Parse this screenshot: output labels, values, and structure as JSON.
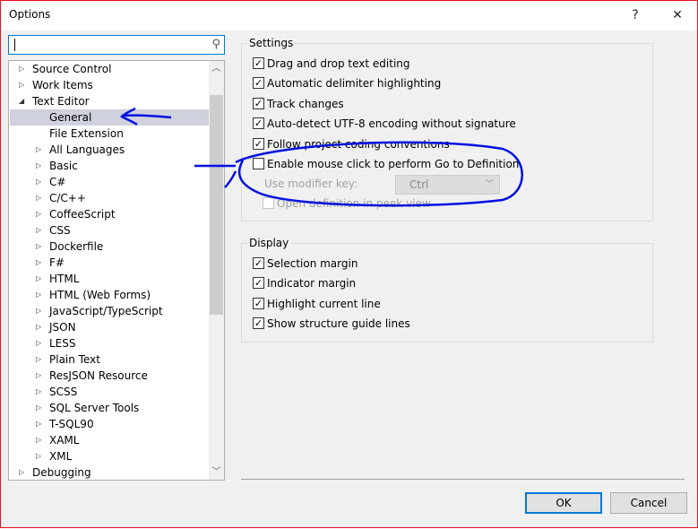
{
  "window": {
    "title": "Options",
    "help": "?",
    "close": "✕"
  },
  "search": {
    "value": "",
    "icon": "search-icon"
  },
  "tree": [
    {
      "label": "Source Control",
      "level": 0,
      "arrow": "collapsed"
    },
    {
      "label": "Work Items",
      "level": 0,
      "arrow": "collapsed"
    },
    {
      "label": "Text Editor",
      "level": 0,
      "arrow": "expanded"
    },
    {
      "label": "General",
      "level": 1,
      "arrow": "none",
      "selected": true
    },
    {
      "label": "File Extension",
      "level": 1,
      "arrow": "none"
    },
    {
      "label": "All Languages",
      "level": 1,
      "arrow": "collapsed"
    },
    {
      "label": "Basic",
      "level": 1,
      "arrow": "collapsed"
    },
    {
      "label": "C#",
      "level": 1,
      "arrow": "collapsed"
    },
    {
      "label": "C/C++",
      "level": 1,
      "arrow": "collapsed"
    },
    {
      "label": "CoffeeScript",
      "level": 1,
      "arrow": "collapsed"
    },
    {
      "label": "CSS",
      "level": 1,
      "arrow": "collapsed"
    },
    {
      "label": "Dockerfile",
      "level": 1,
      "arrow": "collapsed"
    },
    {
      "label": "F#",
      "level": 1,
      "arrow": "collapsed"
    },
    {
      "label": "HTML",
      "level": 1,
      "arrow": "collapsed"
    },
    {
      "label": "HTML (Web Forms)",
      "level": 1,
      "arrow": "collapsed"
    },
    {
      "label": "JavaScript/TypeScript",
      "level": 1,
      "arrow": "collapsed"
    },
    {
      "label": "JSON",
      "level": 1,
      "arrow": "collapsed"
    },
    {
      "label": "LESS",
      "level": 1,
      "arrow": "collapsed"
    },
    {
      "label": "Plain Text",
      "level": 1,
      "arrow": "collapsed"
    },
    {
      "label": "ResJSON Resource",
      "level": 1,
      "arrow": "collapsed"
    },
    {
      "label": "SCSS",
      "level": 1,
      "arrow": "collapsed"
    },
    {
      "label": "SQL Server Tools",
      "level": 1,
      "arrow": "collapsed"
    },
    {
      "label": "T-SQL90",
      "level": 1,
      "arrow": "collapsed"
    },
    {
      "label": "XAML",
      "level": 1,
      "arrow": "collapsed"
    },
    {
      "label": "XML",
      "level": 1,
      "arrow": "collapsed"
    },
    {
      "label": "Debugging",
      "level": 0,
      "arrow": "collapsed"
    }
  ],
  "settings": {
    "title": "Settings",
    "items": [
      {
        "label": "Drag and drop text editing",
        "checked": true
      },
      {
        "label": "Automatic delimiter highlighting",
        "checked": true
      },
      {
        "label": "Track changes",
        "checked": true
      },
      {
        "label": "Auto-detect UTF-8 encoding without signature",
        "checked": true
      },
      {
        "label": "Follow project coding conventions",
        "checked": true
      },
      {
        "label": "Enable mouse click to perform Go to Definition",
        "checked": false
      }
    ],
    "modifier_label": "Use modifier key:",
    "modifier_value": "Ctrl",
    "peek_label": "Open definition in peek view"
  },
  "display": {
    "title": "Display",
    "items": [
      {
        "label": "Selection margin",
        "checked": true
      },
      {
        "label": "Indicator margin",
        "checked": true
      },
      {
        "label": "Highlight current line",
        "checked": true
      },
      {
        "label": "Show structure guide lines",
        "checked": true
      }
    ]
  },
  "buttons": {
    "ok": "OK",
    "cancel": "Cancel"
  },
  "colors": {
    "accent": "#0078d7",
    "annotation": "#0010e0",
    "border": "#e81123"
  }
}
